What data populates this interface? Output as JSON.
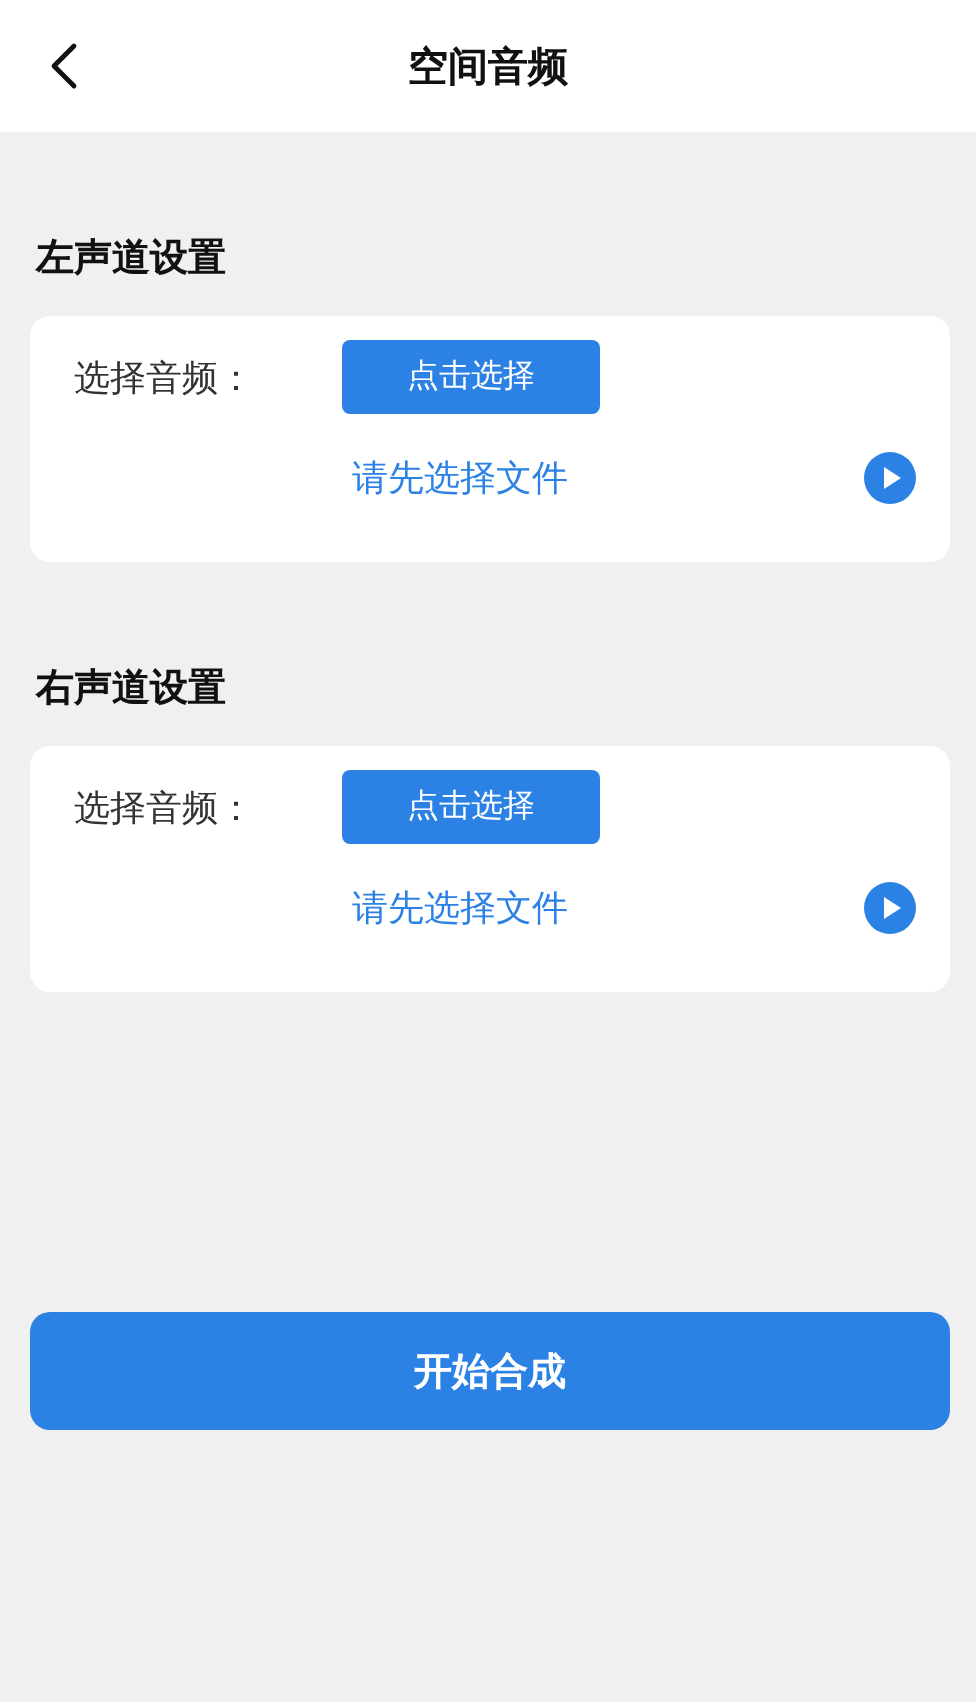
{
  "header": {
    "title": "空间音频"
  },
  "sections": [
    {
      "title": "左声道设置",
      "label": "选择音频：",
      "button": "点击选择",
      "file": "请先选择文件"
    },
    {
      "title": "右声道设置",
      "label": "选择音频：",
      "button": "点击选择",
      "file": "请先选择文件"
    }
  ],
  "submit": "开始合成"
}
